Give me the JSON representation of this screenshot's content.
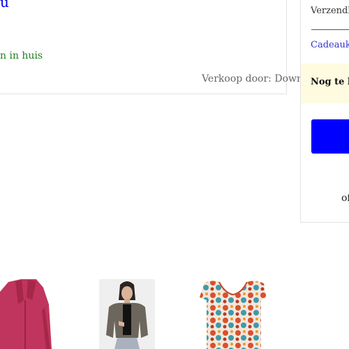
{
  "product": {
    "title_fragment": "u",
    "stock_fragment": "n in huis",
    "seller": "Verkoop door: Downtown.nl"
  },
  "summary": {
    "shipping_fragment": "Verzendl",
    "gift_fragment": "Cadeauk",
    "due_fragment": "Nog te be",
    "or_fragment": "of"
  },
  "colors": {
    "link": "#0000ee",
    "stock": "#1e7f1e",
    "button": "#0000ff",
    "due_bg": "#fffbe0"
  },
  "thumbnails": [
    {
      "icon": "pink-blazer-image"
    },
    {
      "icon": "grey-jacket-model-image"
    },
    {
      "icon": "paisley-top-image"
    }
  ]
}
